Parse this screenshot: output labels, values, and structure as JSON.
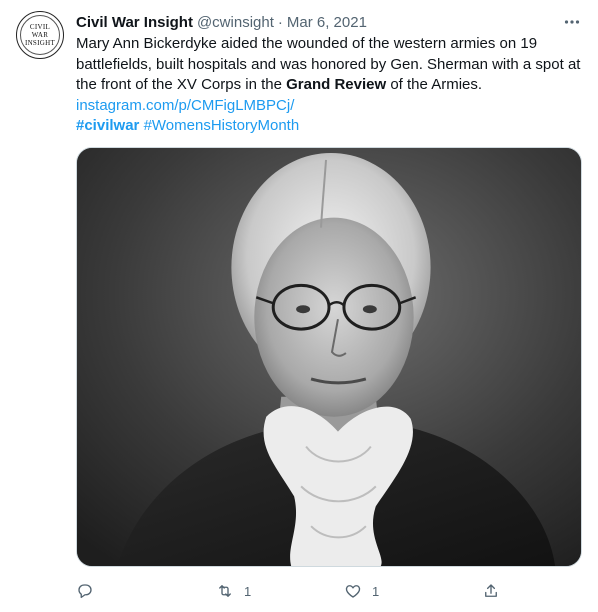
{
  "author": {
    "avatar_text": [
      "CIVIL",
      "WAR",
      "INSIGHT"
    ],
    "name": "Civil War Insight",
    "handle": "@cwinsight",
    "separator": "·",
    "date": "Mar 6, 2021"
  },
  "tweet": {
    "text_part1": "Mary Ann Bickerdyke aided the wounded of the western armies on 19 battlefields, built hospitals and was honored by Gen. Sherman with a spot at the front of the XV Corps in the ",
    "text_bold": "Grand Review",
    "text_part2": " of the Armies.",
    "link": "instagram.com/p/CMFigLMBPCj/",
    "hashtag_1": "#civilwar",
    "hashtag_2": "#WomensHistoryMonth"
  },
  "media": {
    "alt": "Black and white portrait of an elderly woman with round glasses and a white lace collar"
  },
  "actions": {
    "reply_count": "",
    "retweet_count": "1",
    "like_count": "1"
  },
  "colors": {
    "accent": "#1d9bf0",
    "secondary_text": "#536471",
    "primary_text": "#0f1419"
  },
  "icons": {
    "more": "more-horizontal-icon",
    "reply": "reply-icon",
    "retweet": "retweet-icon",
    "like": "heart-icon",
    "share": "share-icon"
  }
}
